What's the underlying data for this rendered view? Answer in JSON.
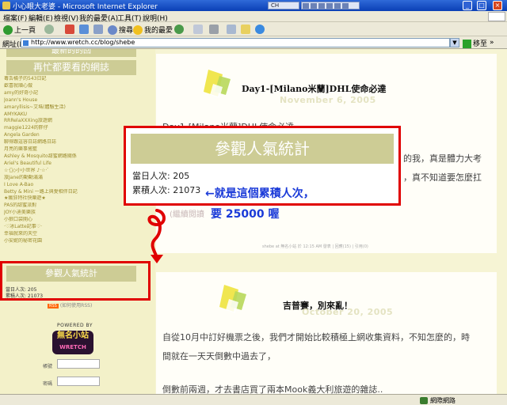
{
  "window": {
    "title": "小心眼大老婆 - Microsoft Internet Explorer",
    "lang_indicator": "CH",
    "minimize": "_",
    "maximize": "□",
    "close": "×"
  },
  "menu": [
    "檔案(F)",
    "編輯(E)",
    "檢視(V)",
    "我的最愛(A)",
    "工具(T)",
    "說明(H)"
  ],
  "toolbar": {
    "back": "上一頁",
    "search": "搜尋",
    "favorites": "我的最愛"
  },
  "address": {
    "label": "網址(D)",
    "url": "http://www.wretch.cc/blog/shebe",
    "go": "移至",
    "links": "»"
  },
  "sidebar": {
    "top_heading": "最新的的回",
    "heading": "再忙都要看的網誌",
    "links": [
      "毒舌橘子的543日記",
      "歡喜就順心做",
      "amy的好奇小記",
      "Joann's House",
      "amaryllisis~艾瑪(體驗生活)",
      "AMYKAKU",
      "RRRelaXXXing旅遊網",
      "maggie1224的胖仔",
      "Angela Garden",
      "聊得跟這容日誌網路日誌",
      "月亮的樂事搖籃",
      "Ashley & Mosquito甜蜜網路關係",
      "Ariel's Beautiful Life",
      "☆‧ﾟ◇小小世界 ♪‧☆‧ﾟ",
      "旅Jane的動動滿滿",
      "I Love A-Bao",
      "Betty & Mini 一路上與愛相伴日記",
      "★瘋狂特社快樂遊★",
      "PAS的甜蜜派對",
      "JOY小迪美樂族",
      "小狼口袋開心",
      "‧♡冰Latte記事♡‧",
      "幸福就來的天空",
      "小安妮的秘密花園"
    ],
    "counter_heading": "參觀人氣統計",
    "today": "當日人次: 205",
    "total": "累積人次: 21073",
    "rss_badge": "RSS",
    "rss_text": "(如何使用RSS)",
    "powered_by": "POWERED BY",
    "logo_text": "無名小站",
    "logo_sub": "WRETCH",
    "login_account": "帳號",
    "login_password": "密碼"
  },
  "post1": {
    "title": "Day1-[Milano米蘭]DHL使命必達",
    "date": "November 6, 2005",
    "body1": "Day1-[Milano米蘭]DHL使命必達",
    "body2_tail": "的我，真是體力大考",
    "body3_tail": "，真不知道要怎麼扛",
    "meta": "shebe at 無名小站 於 12:15 AM 發表 | 回應(15) | 引用(0)"
  },
  "post2": {
    "title": "吉普賽，別來亂！",
    "date": "October 20, 2005",
    "body1": "自從10月中訂好機票之後，我們才開始比較積極上網收集資料，不知怎麼的，時",
    "body2": "間就在一天天倒數中過去了，",
    "body3": "倒數前兩週，才去書店買了兩本Mook義大利旅遊的雜誌.."
  },
  "annotation": {
    "heading": "參觀人氣統計",
    "today": "當日人次: 205",
    "total": "累積人次: 21073",
    "note1": "←就是這個累積人次，",
    "faded": "(繼續閱讀",
    "note2": "要 25000 喔"
  },
  "status": {
    "zone": "網際網路"
  },
  "colors": {
    "sidebar_bg": "#f3f1c9",
    "heading_bg": "#cdcc95",
    "annotation_red": "#e00000",
    "note_blue": "#1a3ad8"
  }
}
